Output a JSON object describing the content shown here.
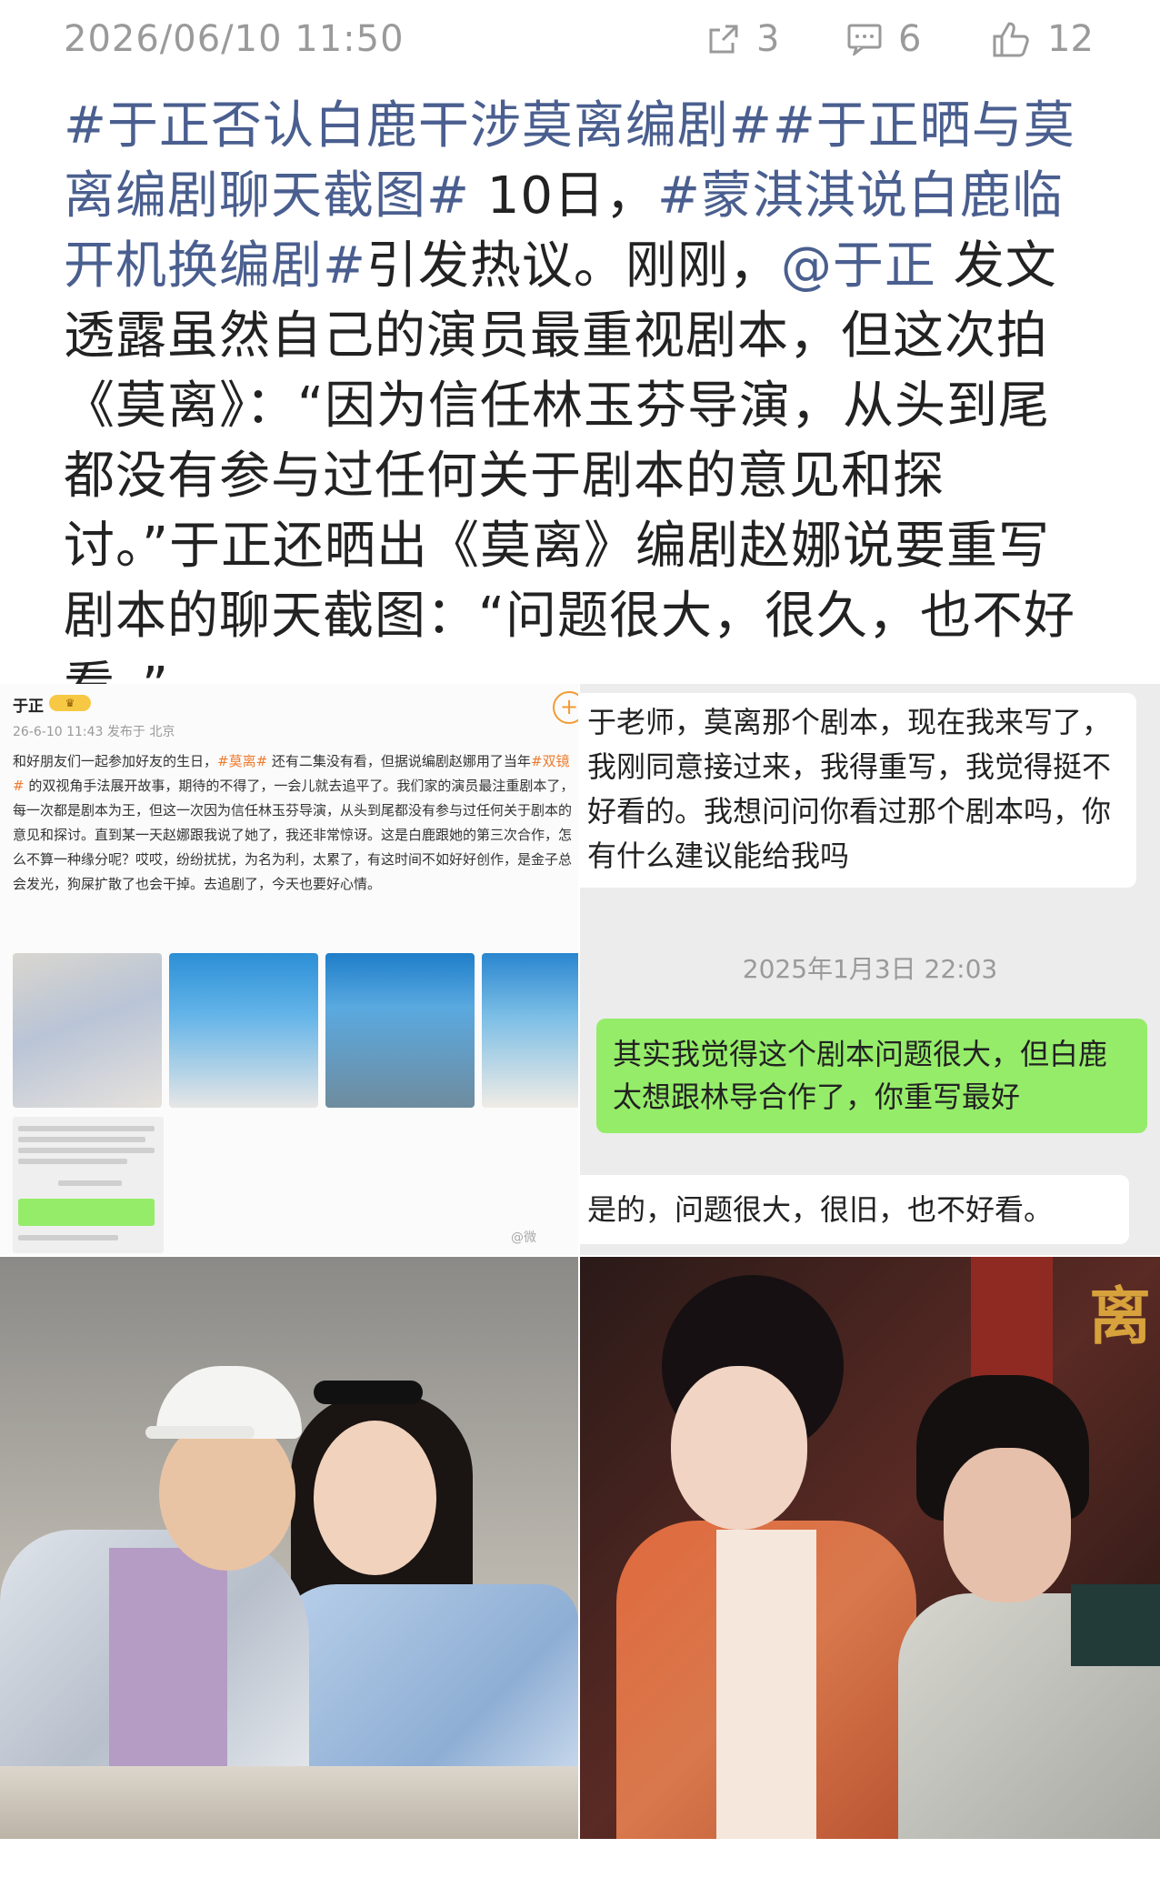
{
  "header": {
    "timestamp": "2026/06/10 11:50",
    "repost_count": "3",
    "comment_count": "6",
    "like_count": "12",
    "icons": [
      "share-icon",
      "comment-icon",
      "like-icon"
    ]
  },
  "post": {
    "tag1": "#于正否认白鹿干涉莫离编剧#",
    "tag2": "#于正晒与莫离编剧聊天截图#",
    "text1": " 10日，",
    "tag3": "#蒙淇淇说白鹿临开机换编剧#",
    "text2": "引发热议。刚刚，",
    "mention": "@于正",
    "text3": " 发文透露虽然自己的演员最重视剧本，但这次拍《莫离》：“因为信任林玉芬导演，从头到尾都没有参与过任何关于剧本的意见和探讨。”于正还晒出《莫离》编剧赵娜说要重写剧本的聊天截图：“问题很大，很久，也不好看。”"
  },
  "mini_post": {
    "name": "于正",
    "badge": "",
    "meta": "26-6-10 11:43 发布于 北京",
    "follow_symbol": "+",
    "body_part1": "和好朋友们一起参加好友的生日，",
    "body_tag1": "#莫离#",
    "body_part2": " 还有二集没有看，但据说编剧赵娜用了当年",
    "body_tag2": "#双镜#",
    "body_part3": " 的双视角手法展开故事，期待的不得了，一会儿就去追平了。我们家的演员最注重剧本了，每一次都是剧本为王，但这一次因为信任林玉芬导演，从头到尾都没有参与过任何关于剧本的意见和探讨。直到某一天赵娜跟我说了她了，我还非常惊讶。这是白鹿跟她的第三次合作，怎么不算一种缘分呢？哎哎，纷纷扰扰，为名为利，太累了，有这时间不如好好创作，是金子总会发光，狗屎扩散了也会干掉。去追剧了，今天也要好心情。",
    "watermark": "@微"
  },
  "chat": {
    "msg1": "于老师，莫离那个剧本，现在我来写了，我刚同意接过来，我得重写，我觉得挺不好看的。我想问问你看过那个剧本吗，你有什么建议能给我吗",
    "time": "2025年1月3日 22:03",
    "msg2": "其实我觉得这个剧本问题很大，但白鹿太想跟林导合作了，你重写最好",
    "msg3": "是的，问题很大，很旧，也不好看。"
  },
  "drama": {
    "title_char": "离"
  },
  "colors": {
    "tag": "#4a5f8f",
    "meta": "#9a9a9a",
    "wechat_green": "#95ec69",
    "mini_tag": "#ef7b2d"
  }
}
